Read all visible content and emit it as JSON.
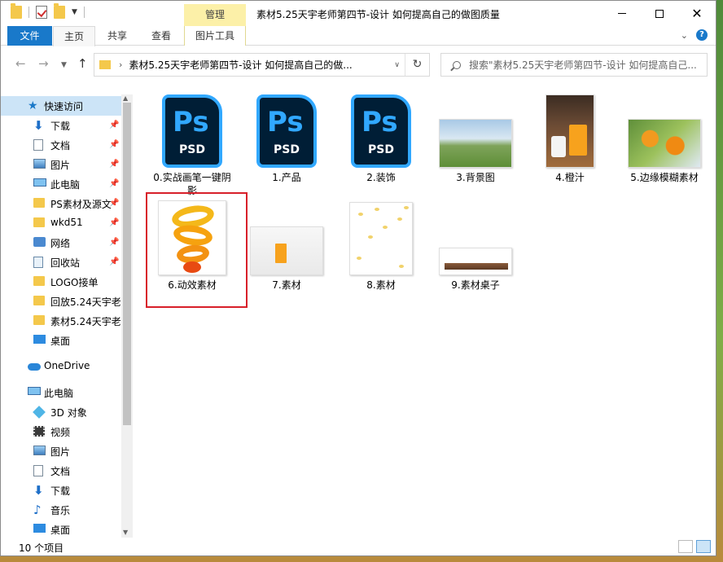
{
  "title_bar": {
    "window_title": "素材5.25天宇老师第四节-设计 如何提高自己的做图质量",
    "contextual_tab_group": "管理",
    "minimize_icon": "minimize-icon",
    "maximize_icon": "maximize-icon",
    "close_glyph": "✕"
  },
  "ribbon": {
    "tabs": [
      "文件",
      "主页",
      "共享",
      "查看",
      "图片工具"
    ],
    "active_tab": "主页",
    "accent_color": "#1979ca",
    "contextual_color": "#fcf0a8"
  },
  "navigation": {
    "back_glyph": "←",
    "forward_glyph": "→",
    "up_glyph": "↑",
    "address_path": "素材5.25天宇老师第四节-设计 如何提高自己的做...",
    "refresh_glyph": "↻",
    "search_placeholder": "搜索\"素材5.25天宇老师第四节-设计 如何提高自己..."
  },
  "sidebar": {
    "quick_access": "快速访问",
    "pinned": [
      {
        "label": "下载",
        "icon": "download-icon"
      },
      {
        "label": "文档",
        "icon": "document-icon"
      },
      {
        "label": "图片",
        "icon": "picture-icon"
      },
      {
        "label": "此电脑",
        "icon": "pc-icon"
      },
      {
        "label": "PS素材及源文",
        "icon": "folder-icon"
      },
      {
        "label": "wkd51",
        "icon": "folder-icon"
      },
      {
        "label": "网络",
        "icon": "network-icon"
      },
      {
        "label": "回收站",
        "icon": "recycle-bin-icon"
      }
    ],
    "recent": [
      {
        "label": "LOGO接单",
        "icon": "folder-icon"
      },
      {
        "label": "回放5.24天宇老!",
        "icon": "folder-icon"
      },
      {
        "label": "素材5.24天宇老!",
        "icon": "folder-icon"
      },
      {
        "label": "桌面",
        "icon": "desktop-icon"
      }
    ],
    "onedrive": "OneDrive",
    "this_pc": "此电脑",
    "pc_items": [
      {
        "label": "3D 对象",
        "icon": "3d-objects-icon"
      },
      {
        "label": "视频",
        "icon": "video-icon"
      },
      {
        "label": "图片",
        "icon": "picture-icon"
      },
      {
        "label": "文档",
        "icon": "document-icon"
      },
      {
        "label": "下载",
        "icon": "download-icon"
      },
      {
        "label": "音乐",
        "icon": "music-icon"
      },
      {
        "label": "桌面",
        "icon": "desktop-icon"
      }
    ]
  },
  "files": [
    {
      "name": "0.实战画笔一键阴影",
      "type": "psd",
      "badge_big": "Ps",
      "badge_small": "PSD"
    },
    {
      "name": "1.产品",
      "type": "psd",
      "badge_big": "Ps",
      "badge_small": "PSD"
    },
    {
      "name": "2.装饰",
      "type": "psd",
      "badge_big": "Ps",
      "badge_small": "PSD"
    },
    {
      "name": "3.背景图",
      "type": "image"
    },
    {
      "name": "4.橙汁",
      "type": "image"
    },
    {
      "name": "5.边缘模糊素材",
      "type": "image"
    },
    {
      "name": "6.动效素材",
      "type": "image",
      "selected": true
    },
    {
      "name": "7.素材",
      "type": "image"
    },
    {
      "name": "8.素材",
      "type": "image"
    },
    {
      "name": "9.素材桌子",
      "type": "image"
    }
  ],
  "status_bar": {
    "item_count": "10 个项目"
  }
}
